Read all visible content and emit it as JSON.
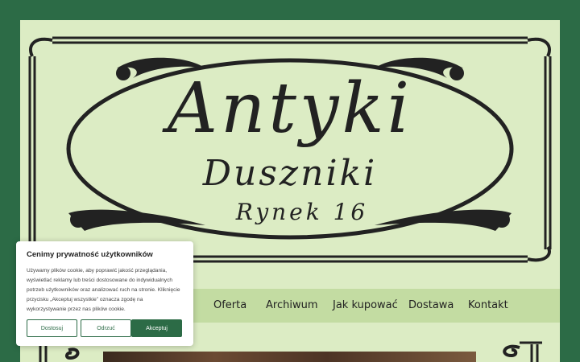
{
  "logo": {
    "line1": "Antyki",
    "line2": "Duszniki",
    "line3": "Rynek 16"
  },
  "nav": {
    "items": [
      {
        "label": "Oferta"
      },
      {
        "label": "Archiwum"
      },
      {
        "label": "Jak kupować"
      },
      {
        "label": "Dostawa"
      },
      {
        "label": "Kontakt"
      }
    ]
  },
  "cookie_banner": {
    "title": "Cenimy prywatność użytkowników",
    "text": "Używamy plików cookie, aby poprawić jakość przeglądania, wyświetlać reklamy lub treści dostosowane do indywidualnych potrzeb użytkowników oraz analizować ruch na stronie. Kliknięcie przycisku „Akceptuj wszystkie” oznacza zgodę na wykorzystywanie przez nas plików cookie.",
    "customize_label": "Dostosuj",
    "reject_label": "Odrzuć",
    "accept_label": "Akceptuj"
  },
  "colors": {
    "background": "#2c6b46",
    "page": "#dcecc4",
    "nav": "#c3dca2",
    "accent": "#2c6b46"
  }
}
